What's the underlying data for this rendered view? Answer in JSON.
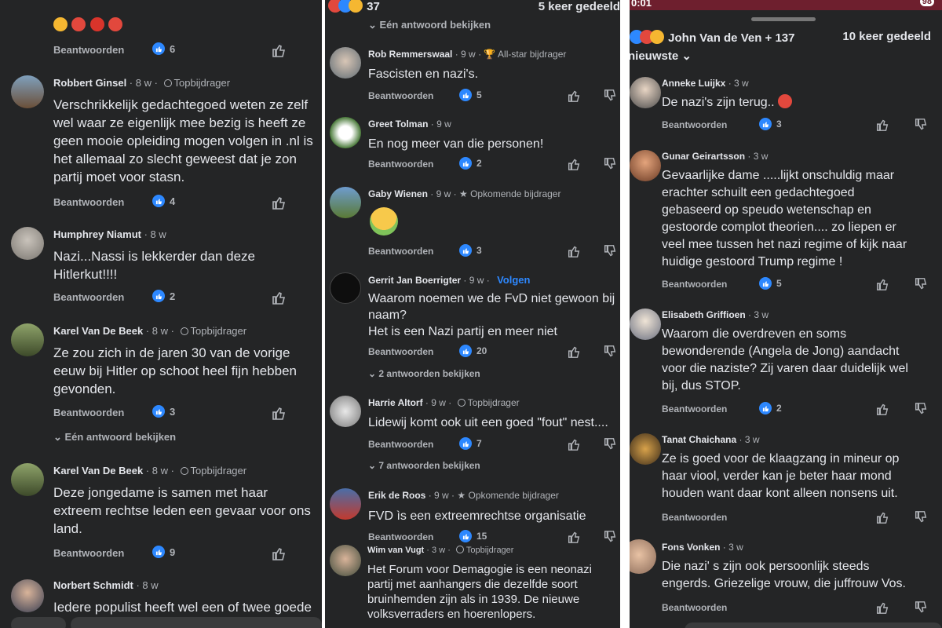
{
  "actions": {
    "reply": "Beantwoorden"
  },
  "panel1": {
    "top_likes": "6",
    "comments": [
      {
        "name": "Robbert Ginsel",
        "time": "8 w",
        "badge": "Topbijdrager",
        "lines": [
          "Verschrikkelijk gedachtegoed weten ze zelf",
          "wel waar ze eigenlijk mee bezig is heeft ze",
          "geen mooie opleiding mogen volgen in .nl is",
          "het allemaal zo slecht geweest dat je zon",
          "partij moet voor stasn."
        ],
        "likes": "4"
      },
      {
        "name": "Humphrey Niamut",
        "time": "8 w",
        "badge": "",
        "lines": [
          "Nazi...Nassi is lekkerder dan deze",
          "Hitlerkut!!!!"
        ],
        "likes": "2"
      },
      {
        "name": "Karel Van De Beek",
        "time": "8 w",
        "badge": "Topbijdrager",
        "lines": [
          "Ze zou zich in de jaren 30 van de vorige",
          "eeuw bij Hitler op schoot heel fijn hebben",
          "gevonden."
        ],
        "likes": "3",
        "expand": "Eén antwoord bekijken"
      },
      {
        "name": "Karel Van De Beek",
        "time": "8 w",
        "badge": "Topbijdrager",
        "lines": [
          "Deze jongedame is samen met haar",
          "extreem rechtse leden een gevaar voor ons",
          "land."
        ],
        "likes": "9"
      },
      {
        "name": "Norbert Schmidt",
        "time": "8 w",
        "badge": "",
        "lines": [
          "Iedere populist heeft wel een of twee goede"
        ]
      }
    ]
  },
  "panel2": {
    "header": {
      "count": "37",
      "shares": "5 keer gedeeld"
    },
    "top_expand": "Eén antwoord bekijken",
    "comments": [
      {
        "name": "Rob Remmerswaal",
        "time": "9 w",
        "badge": "All-star bijdrager",
        "lines": [
          "Fascisten en nazi's."
        ],
        "likes": "5"
      },
      {
        "name": "Greet Tolman",
        "time": "9 w",
        "badge": "",
        "lines": [
          "En nog meer van die personen!"
        ],
        "likes": "2"
      },
      {
        "name": "Gaby Wienen",
        "time": "9 w",
        "badge": "Opkomende bijdrager",
        "lines": [],
        "likes": "3"
      },
      {
        "name": "Gerrit Jan Boerrigter",
        "time": "9 w",
        "follow": "Volgen",
        "lines": [
          "Waarom noemen we de FvD niet gewoon bij",
          "naam?",
          "Het is een Nazi partij en meer niet"
        ],
        "likes": "20",
        "expand": "2 antwoorden bekijken"
      },
      {
        "name": "Harrie Altorf",
        "time": "9 w",
        "badge": "Topbijdrager",
        "lines": [
          "Lidewij komt ook uit een goed \"fout\" nest...."
        ],
        "likes": "7",
        "expand": "7 antwoorden bekijken"
      },
      {
        "name": "Erik de Roos",
        "time": "9 w",
        "badge": "Opkomende bijdrager",
        "lines": [
          "FVD ìs een extreemrechtse organisatie"
        ],
        "likes": "15"
      },
      {
        "name": "Wim van Vugt",
        "time": "3 w",
        "badge": "Topbijdrager",
        "lines": [
          "Het Forum voor Demagogie is een neonazi",
          "partij met aanhangers die dezelfde soort",
          "bruinhemden zijn als in 1939. De nieuwe",
          "volksverraders en hoerenlopers."
        ]
      }
    ]
  },
  "panel3": {
    "status": {
      "time": "0:01",
      "battery": "98"
    },
    "header": {
      "names": "John Van de Ven + 137",
      "shares": "10 keer gedeeld",
      "sort": "nieuwste"
    },
    "comments": [
      {
        "name": "Anneke Luijkx",
        "time": "3 w",
        "lines": [
          "De nazi's zijn terug.."
        ],
        "likes": "3"
      },
      {
        "name": "Gunar Geirartsson",
        "time": "3 w",
        "lines": [
          "Gevaarlijke dame .....lijkt onschuldig maar",
          "erachter schuilt een gedachtegoed",
          "gebaseerd op speudo wetenschap en",
          "gestoorde complot theorien.... zo liepen er",
          "veel mee tussen het nazi regime of kijk naar",
          "huidige gestoord Trump regime !"
        ],
        "likes": "5"
      },
      {
        "name": "Elisabeth Griffioen",
        "time": "3 w",
        "lines": [
          "Waarom die overdreven en soms",
          "bewonderende (Angela de Jong)  aandacht",
          "voor die naziste? Zij varen daar duidelijk wel",
          "bij, dus STOP."
        ],
        "likes": "2"
      },
      {
        "name": "Tanat Chaichana",
        "time": "3 w",
        "lines": [
          "Ze is goed voor de klaagzang in mineur op",
          "haar viool, verder kan je beter haar mond",
          "houden want daar kont alleen nonsens uit."
        ]
      },
      {
        "name": "Fons Vonken",
        "time": "3 w",
        "lines": [
          "Die nazi' s zijn ook persoonlijk steeds",
          "engerds. Griezelige vrouw, die juffrouw Vos."
        ]
      }
    ]
  },
  "colors": {
    "bg": "#242526",
    "text": "#e4e6eb",
    "muted": "#b0b3b8",
    "like": "#2d88ff",
    "follow": "#2d88ff"
  }
}
